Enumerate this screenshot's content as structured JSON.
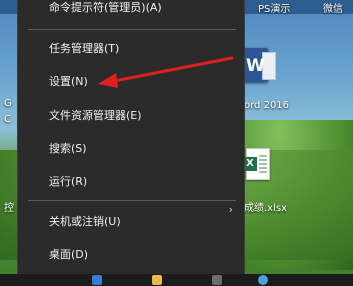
{
  "desktop": {
    "top_right_left": "PS演示",
    "top_right_right": "微信",
    "word_label": "ord 2016",
    "excel_label": "成绩.xlsx",
    "left_edge_g": "G",
    "left_edge_c": "C",
    "left_edge_c2": "控"
  },
  "menu": {
    "items": [
      {
        "label": "命令提示符(管理员)(A)"
      },
      {
        "label": "任务管理器(T)"
      },
      {
        "label": "设置(N)"
      },
      {
        "label": "文件资源管理器(E)"
      },
      {
        "label": "搜索(S)"
      },
      {
        "label": "运行(R)"
      },
      {
        "label": "关机或注销(U)"
      },
      {
        "label": "桌面(D)"
      }
    ],
    "submenu_arrow": "›"
  },
  "colors": {
    "menu_bg": "#2b2b2b",
    "menu_text": "#f2f2f2",
    "annotation_arrow": "#e02020"
  }
}
